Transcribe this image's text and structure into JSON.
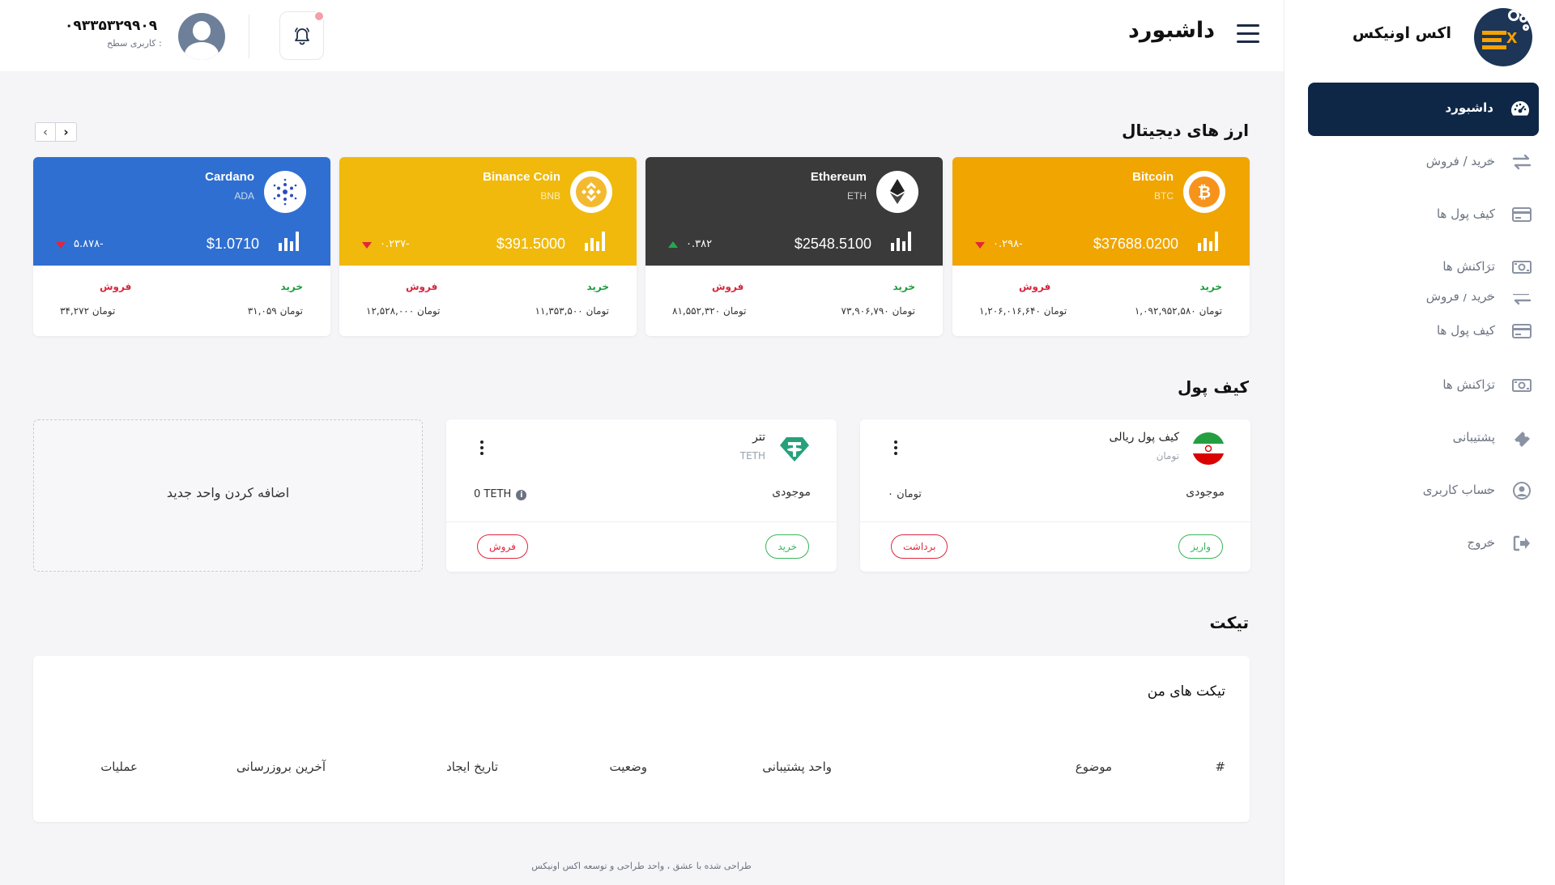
{
  "brand": {
    "name": "اکس اونیکس"
  },
  "sidebar": {
    "items": [
      {
        "label": "داشبورد",
        "icon": "gauge-icon",
        "active": true,
        "chevron": false
      },
      {
        "label": "خرید / فروش",
        "icon": "swap-arrows-icon",
        "chevron": true
      },
      {
        "label": "کیف پول ها",
        "icon": "credit-card-icon",
        "chevron": false
      },
      {
        "label": "تراکنش ها",
        "icon": "money-bill-icon",
        "chevron": true
      },
      {
        "label": "خرید / فروش",
        "icon": "swap-arrows-icon",
        "chevron": true
      },
      {
        "label": "کیف پول ها",
        "icon": "credit-card-icon",
        "chevron": false
      },
      {
        "label": "تراکنش ها",
        "icon": "money-bill-icon",
        "chevron": true
      },
      {
        "label": "پشتیبانی",
        "icon": "ticket-icon",
        "chevron": false
      },
      {
        "label": "حساب کاربری",
        "icon": "user-circle-icon",
        "chevron": true
      },
      {
        "label": "خروج",
        "icon": "logout-icon",
        "chevron": true
      }
    ],
    "chevron_glyph": "‹"
  },
  "header": {
    "title": "داشبورد",
    "user": {
      "phone": "۰۹۳۳۵۳۲۹۹۰۹",
      "level": "کاربری سطح :"
    }
  },
  "crypto": {
    "title": "ارز های دیجیتال",
    "prev": "‹",
    "next": "›",
    "buy_label": "خرید",
    "sell_label": "فروش",
    "coins": [
      {
        "name": "Bitcoin",
        "symbol": "BTC",
        "price": "$37688.0200",
        "change": "۰.۲۹۸-",
        "direction": "down",
        "color": "#f0a500",
        "buy": "۱,۰۹۲,۹۵۲,۵۸۰ تومان",
        "sell": "۱,۲۰۶,۰۱۶,۶۴۰ تومان",
        "icon": "bitcoin-icon"
      },
      {
        "name": "Ethereum",
        "symbol": "ETH",
        "price": "$2548.5100",
        "change": "۰.۳۸۲",
        "direction": "up",
        "color": "#3a3a3a",
        "buy": "۷۳,۹۰۶,۷۹۰ تومان",
        "sell": "۸۱,۵۵۲,۳۲۰ تومان",
        "icon": "ethereum-icon"
      },
      {
        "name": "Binance Coin",
        "symbol": "BNB",
        "price": "$391.5000",
        "change": "۰.۲۳۷-",
        "direction": "down",
        "color": "#f0b90b",
        "buy": "۱۱,۳۵۳,۵۰۰ تومان",
        "sell": "۱۲,۵۲۸,۰۰۰ تومان",
        "icon": "bnb-icon"
      },
      {
        "name": "Cardano",
        "symbol": "ADA",
        "price": "$1.0710",
        "change": "۵.۸۷۸-",
        "direction": "down",
        "color": "#2f6fd1",
        "buy": "۳۱,۰۵۹ تومان",
        "sell": "۳۴,۲۷۲ تومان",
        "icon": "cardano-icon"
      }
    ]
  },
  "wallets": {
    "title": "کیف پول",
    "balance_label": "موجودی",
    "items": [
      {
        "name": "کیف پول ریالی",
        "unit": "تومان",
        "balance": "۰ تومان",
        "primary": "واریز",
        "secondary": "برداشت",
        "icon": "iran-flag-icon",
        "info": false
      },
      {
        "name": "تتر",
        "unit": "TETH",
        "balance": "0 TETH",
        "primary": "خرید",
        "secondary": "فروش",
        "icon": "tether-icon",
        "info": true
      }
    ],
    "add_label": "اضافه کردن واحد جدید"
  },
  "tickets": {
    "section_title": "تیکت",
    "card_title": "تیکت های من",
    "columns": [
      "#",
      "موضوع",
      "واحد پشتیبانی",
      "وضعیت",
      "تاریخ ایجاد",
      "آخرین بروزرسانی",
      "عملیات"
    ]
  },
  "footer": {
    "text": "طراحی شده با عشق ، واحد طراحی و توسعه اکس اونیکس"
  },
  "colors": {
    "sidebar_active": "#0f2747",
    "buy": "#1a9d3a",
    "sell": "#d7263d"
  }
}
